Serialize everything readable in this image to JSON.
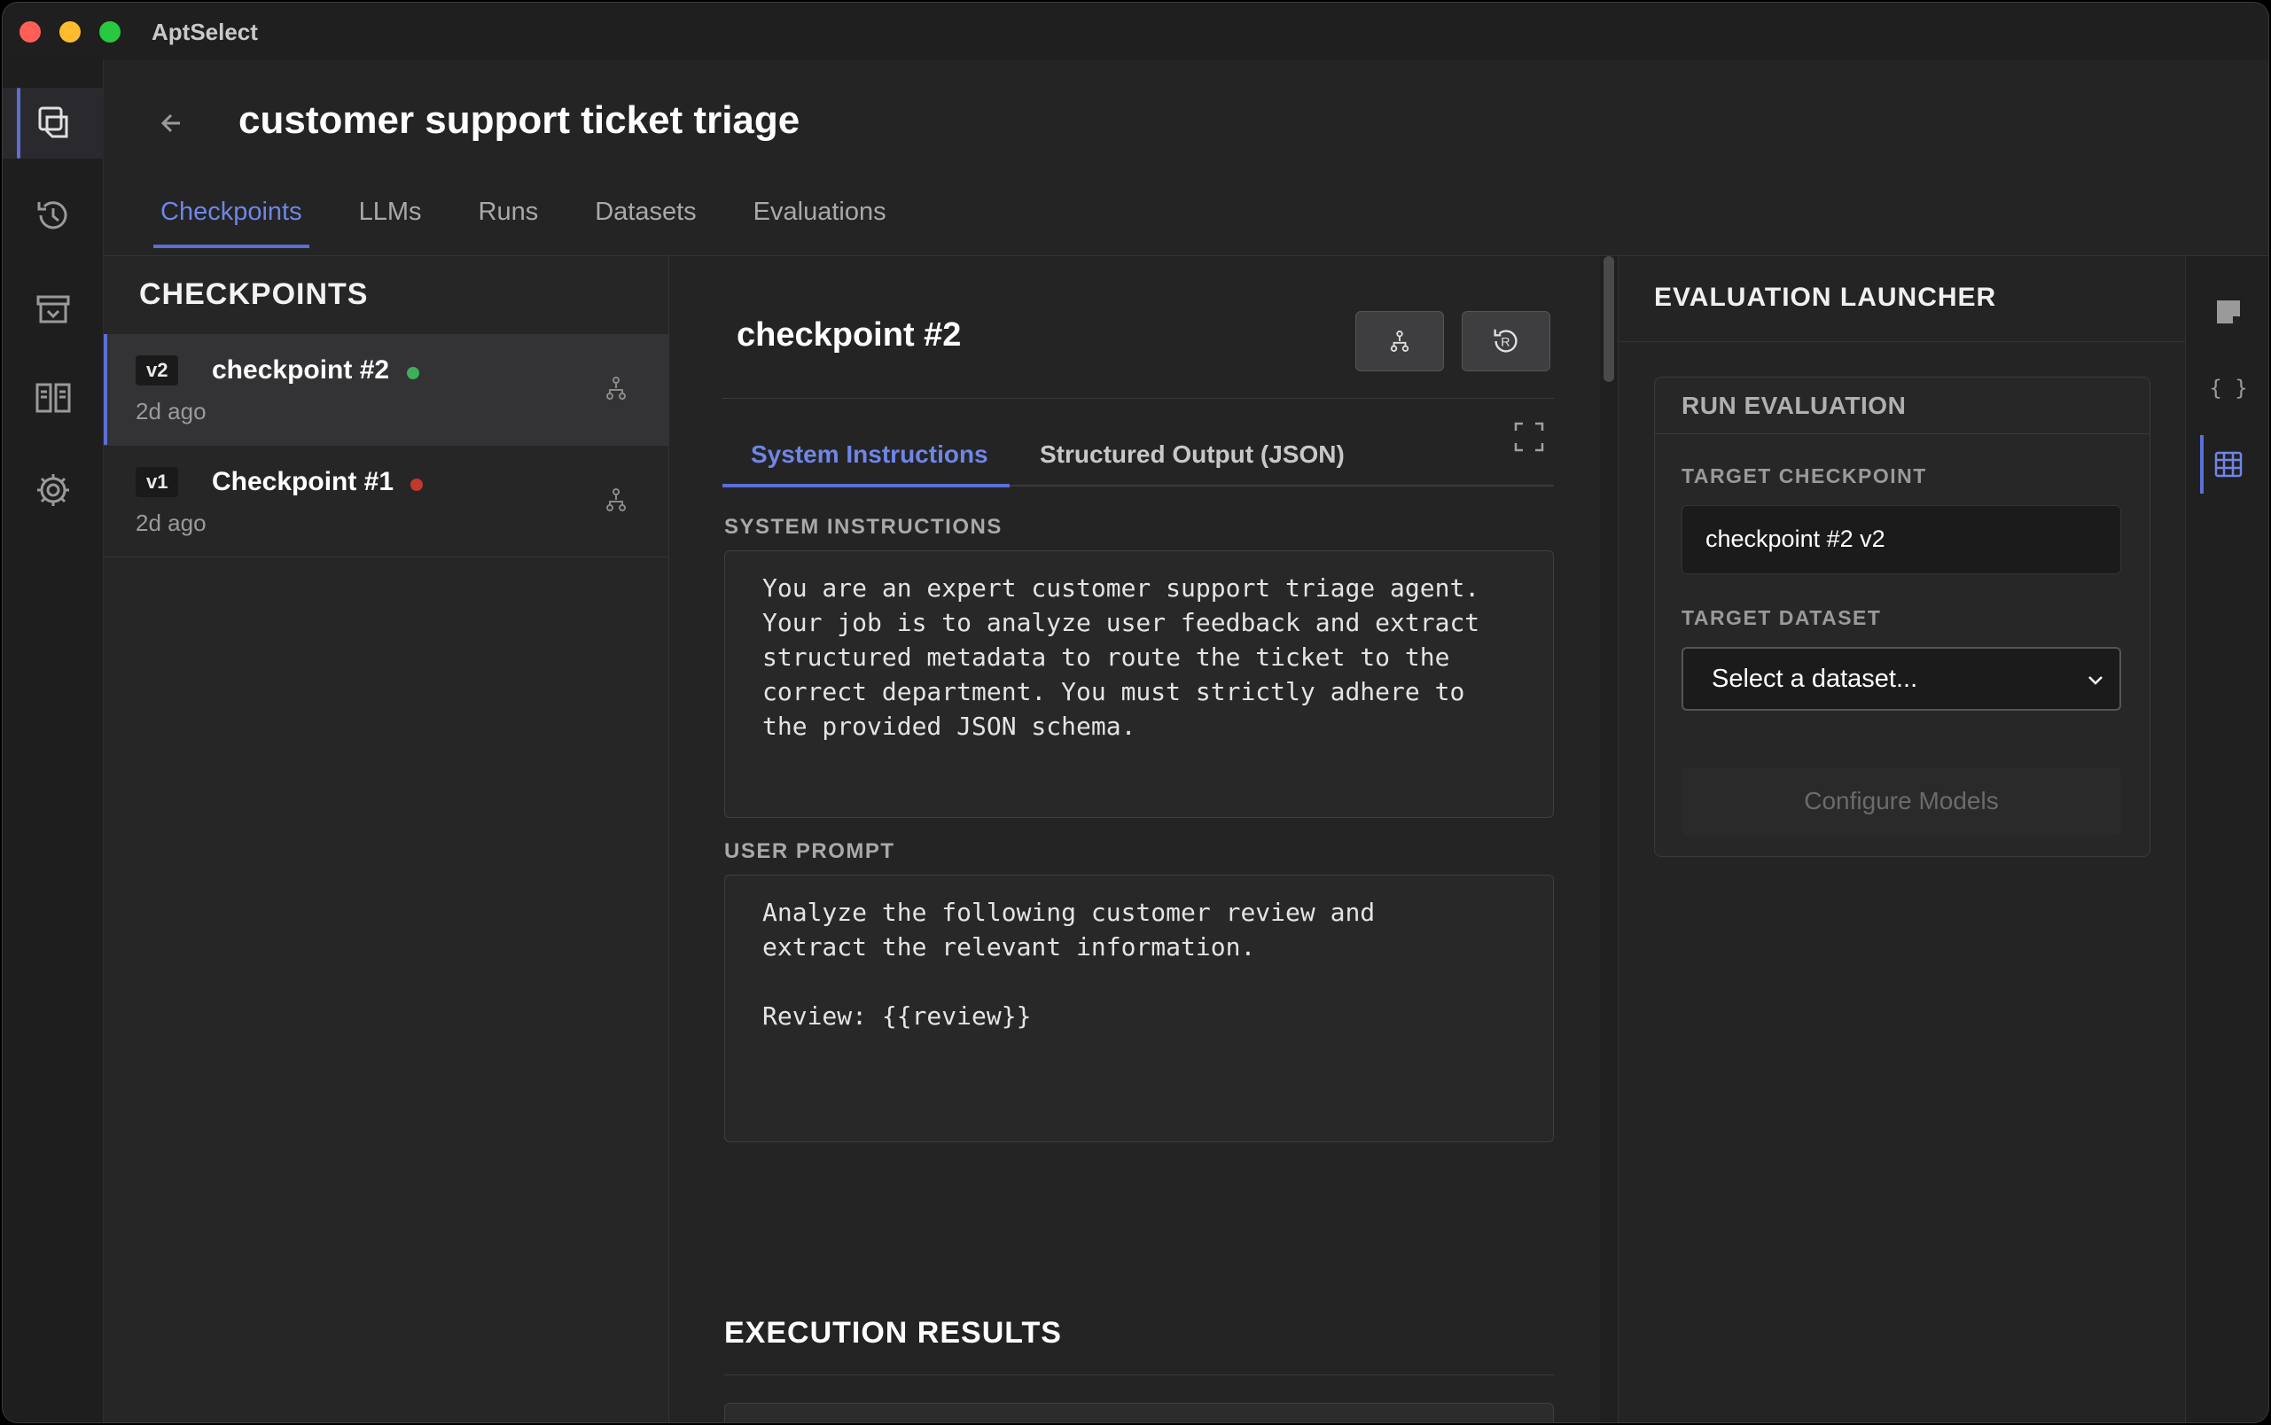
{
  "app": {
    "title": "AptSelect"
  },
  "header": {
    "title": "customer support ticket triage",
    "tabs": [
      {
        "label": "Checkpoints",
        "active": true
      },
      {
        "label": "LLMs"
      },
      {
        "label": "Runs"
      },
      {
        "label": "Datasets"
      },
      {
        "label": "Evaluations"
      }
    ]
  },
  "checkpoints": {
    "heading": "CHECKPOINTS",
    "items": [
      {
        "version": "v2",
        "name": "checkpoint #2",
        "time": "2d ago",
        "status_color": "#3fae5a",
        "active": true
      },
      {
        "version": "v1",
        "name": "Checkpoint #1",
        "time": "2d ago",
        "status_color": "#c0392b"
      }
    ]
  },
  "editor": {
    "title": "checkpoint #2",
    "sub_tabs": [
      {
        "label": "System Instructions",
        "active": true
      },
      {
        "label": "Structured Output (JSON)"
      }
    ],
    "system_label": "SYSTEM INSTRUCTIONS",
    "system_text": "You are an expert customer support triage agent.\nYour job is to analyze user feedback and extract\nstructured metadata to route the ticket to the\ncorrect department. You must strictly adhere to\nthe provided JSON schema.",
    "prompt_label": "USER PROMPT",
    "prompt_text": "Analyze the following customer review and\nextract the relevant information.\n\nReview: {{review}}",
    "exec_title": "EXECUTION RESULTS"
  },
  "launcher": {
    "title": "EVALUATION LAUNCHER",
    "card_title": "RUN EVALUATION",
    "target_checkpoint_label": "TARGET CHECKPOINT",
    "target_checkpoint_value": "checkpoint #2 v2",
    "target_dataset_label": "TARGET DATASET",
    "target_dataset_value": "Select a dataset...",
    "button_label": "Configure Models"
  },
  "colors": {
    "accent": "#5b6fd6",
    "accent_text": "#6f85e8"
  }
}
